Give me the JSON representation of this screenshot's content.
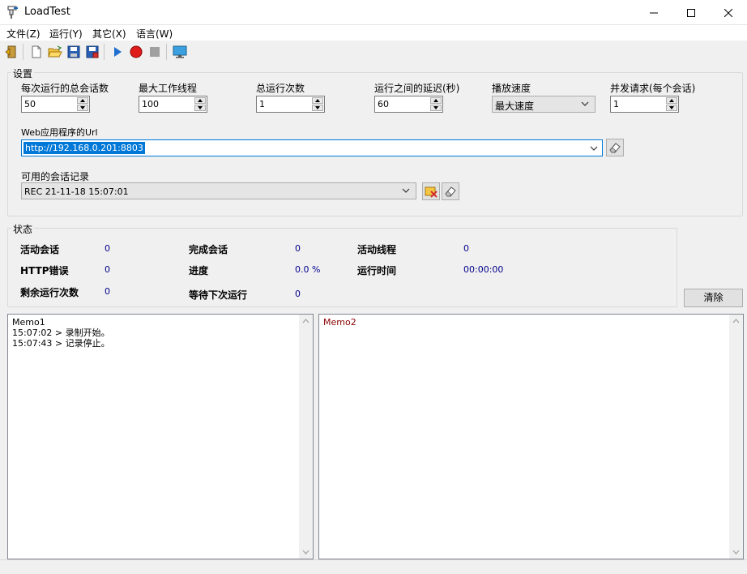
{
  "window": {
    "title": "LoadTest"
  },
  "menu": [
    "文件(Z)",
    "运行(Y)",
    "其它(X)",
    "语言(W)"
  ],
  "toolbar": {
    "buttons": [
      "exit-icon",
      "new-file-icon",
      "open-folder-icon",
      "save-icon",
      "save-as-icon",
      "play-icon",
      "record-icon",
      "stop-icon",
      "monitor-icon"
    ]
  },
  "settings": {
    "title": "设置",
    "fields": [
      {
        "label": "每次运行的总会话数",
        "value": "50"
      },
      {
        "label": "最大工作线程",
        "value": "100"
      },
      {
        "label": "总运行次数",
        "value": "1"
      },
      {
        "label": "运行之间的延迟(秒)",
        "value": "60"
      },
      {
        "label": "播放速度",
        "value": "最大速度"
      },
      {
        "label": "并发请求(每个会话)",
        "value": "1"
      }
    ],
    "url_label": "Web应用程序的Url",
    "url_value": "http://192.168.0.201:8803",
    "sessions_label": "可用的会话记录",
    "sessions_value": "REC 21-11-18 15:07:01"
  },
  "status": {
    "title": "状态",
    "items": [
      {
        "label": "活动会话",
        "value": "0"
      },
      {
        "label": "完成会话",
        "value": "0"
      },
      {
        "label": "活动线程",
        "value": "0"
      },
      {
        "label": "HTTP错误",
        "value": "0"
      },
      {
        "label": "进度",
        "value": "0.0 %"
      },
      {
        "label": "运行时间",
        "value": "00:00:00"
      },
      {
        "label": "剩余运行次数",
        "value": "0"
      },
      {
        "label": "等待下次运行",
        "value": "0"
      }
    ],
    "clear_label": "清除"
  },
  "memo1": {
    "lines": [
      "Memo1",
      "15:07:02 > 录制开始。",
      "15:07:43 > 记录停止。"
    ]
  },
  "memo2": {
    "lines": [
      "Memo2"
    ],
    "color": "#8b0000"
  }
}
